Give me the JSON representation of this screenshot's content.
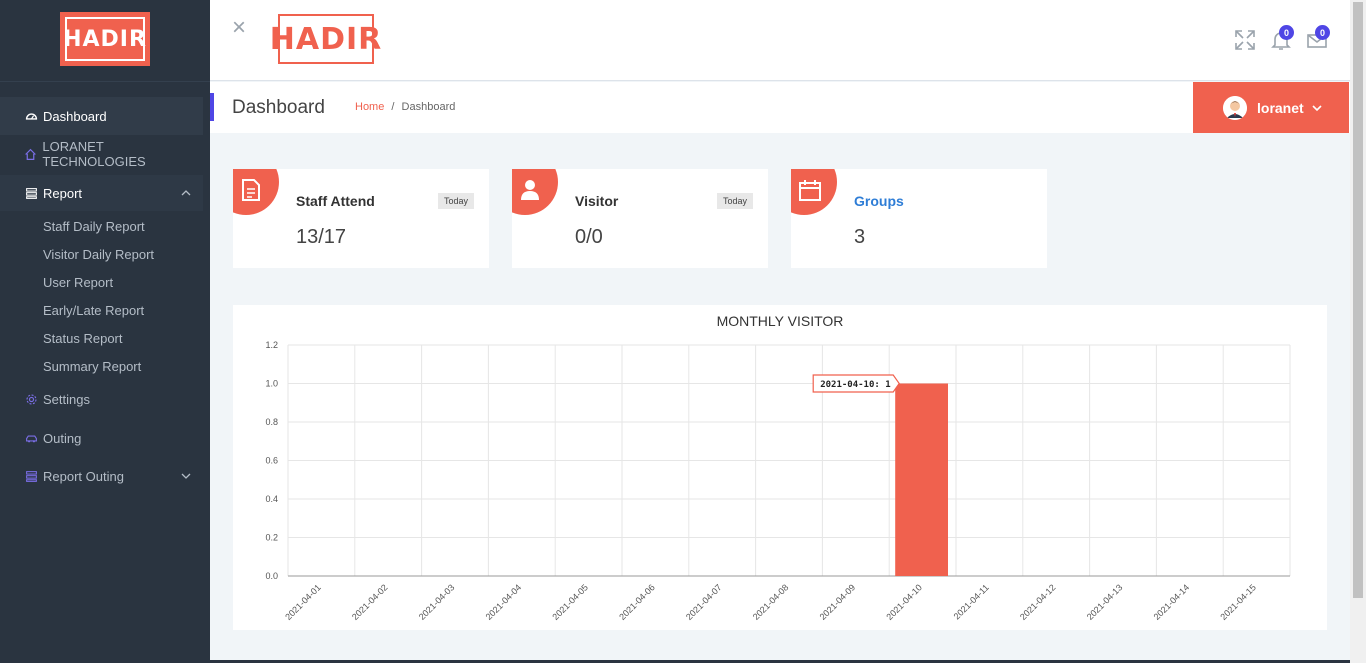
{
  "brand": {
    "logo_text": "HADIR"
  },
  "sidebar": {
    "items": [
      {
        "label": "Dashboard"
      },
      {
        "label": "LORANET TECHNOLOGIES"
      },
      {
        "label": "Report"
      },
      {
        "label": "Settings"
      },
      {
        "label": "Outing"
      },
      {
        "label": "Report Outing"
      }
    ],
    "report_subitems": [
      "Staff Daily Report",
      "Visitor Daily Report",
      "User Report",
      "Early/Late Report",
      "Status Report",
      "Summary Report"
    ]
  },
  "topbar": {
    "close_glyph": "×",
    "notifications_count": "0",
    "messages_count": "0"
  },
  "page": {
    "title": "Dashboard",
    "breadcrumb_home": "Home",
    "breadcrumb_sep": "/",
    "breadcrumb_current": "Dashboard"
  },
  "user": {
    "name": "loranet"
  },
  "cards": [
    {
      "label": "Staff Attend",
      "tag": "Today",
      "value": "13/17"
    },
    {
      "label": "Visitor",
      "tag": "Today",
      "value": "0/0"
    },
    {
      "label": "Groups",
      "tag": "",
      "value": "3"
    }
  ],
  "colors": {
    "accent": "#f0614e",
    "sidebar": "#2a3440",
    "badge": "#4f46e5",
    "link": "#2e7dd6"
  },
  "chart_data": {
    "type": "bar",
    "title": "MONTHLY VISITOR",
    "categories": [
      "2021-04-01",
      "2021-04-02",
      "2021-04-03",
      "2021-04-04",
      "2021-04-05",
      "2021-04-06",
      "2021-04-07",
      "2021-04-08",
      "2021-04-09",
      "2021-04-10",
      "2021-04-11",
      "2021-04-12",
      "2021-04-13",
      "2021-04-14",
      "2021-04-15"
    ],
    "values": [
      0,
      0,
      0,
      0,
      0,
      0,
      0,
      0,
      0,
      1,
      0,
      0,
      0,
      0,
      0
    ],
    "ylim": [
      0,
      1.2
    ],
    "yticks": [
      "0.0",
      "0.2",
      "0.4",
      "0.6",
      "0.8",
      "1.0",
      "1.2"
    ],
    "grid": true,
    "tooltip": "2021-04-10: 1",
    "bar_color": "#f0614e"
  }
}
